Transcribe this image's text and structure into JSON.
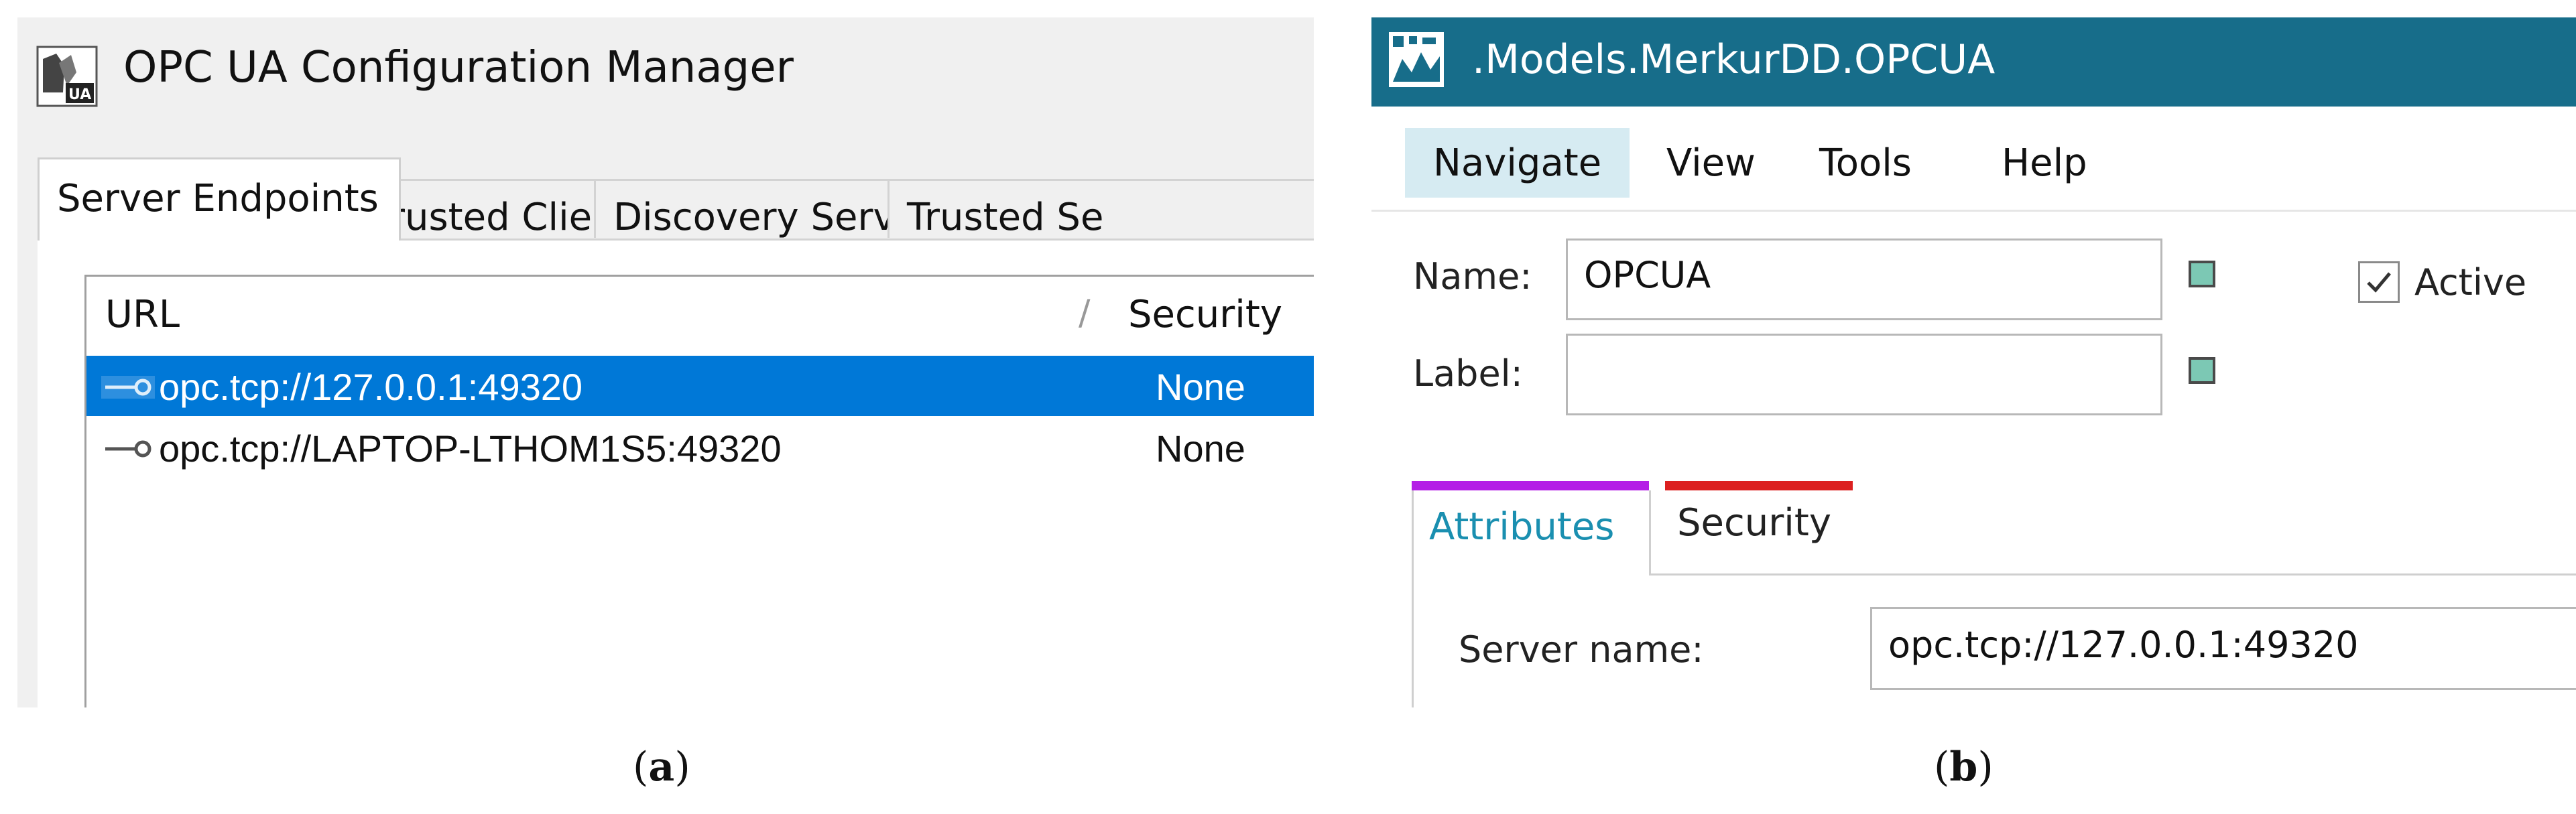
{
  "panel_a": {
    "window_title": "OPC UA Configuration Manager",
    "app_icon": "opc-ua-logo-icon",
    "tabs": [
      {
        "label": "Server Endpoints",
        "active": true
      },
      {
        "label": "Trusted Clients",
        "active": false
      },
      {
        "label": "Discovery Servers",
        "active": false
      },
      {
        "label": "Trusted Se",
        "active": false
      }
    ],
    "columns": [
      "URL",
      "Security"
    ],
    "rows": [
      {
        "url": "opc.tcp://127.0.0.1:49320",
        "security": "None",
        "selected": true,
        "icon": "endpoint-key-icon"
      },
      {
        "url": "opc.tcp://LAPTOP-LTHOM1S5:49320",
        "security": "None",
        "selected": false,
        "icon": "endpoint-key-icon"
      }
    ],
    "caption_letter": "a"
  },
  "panel_b": {
    "window_title": ".Models.MerkurDD.OPCUA",
    "title_icon": "app-model-icon",
    "title_bar_color": "#176d8a",
    "menu": [
      {
        "label": "Navigate",
        "active": true
      },
      {
        "label": "View",
        "active": false
      },
      {
        "label": "Tools",
        "active": false
      },
      {
        "label": "Help",
        "active": false
      }
    ],
    "name_label": "Name:",
    "name_value": "OPCUA",
    "label_label": "Label:",
    "label_value": "",
    "active_label": "Active",
    "active_checked": true,
    "tabs": [
      {
        "label": "Attributes",
        "active": true,
        "accent_color": "#b41ee6"
      },
      {
        "label": "Security",
        "active": false,
        "accent_color": "#dc2020"
      }
    ],
    "server_name_label": "Server name:",
    "server_name_value": "opc.tcp://127.0.0.1:49320",
    "caption_letter": "b"
  }
}
